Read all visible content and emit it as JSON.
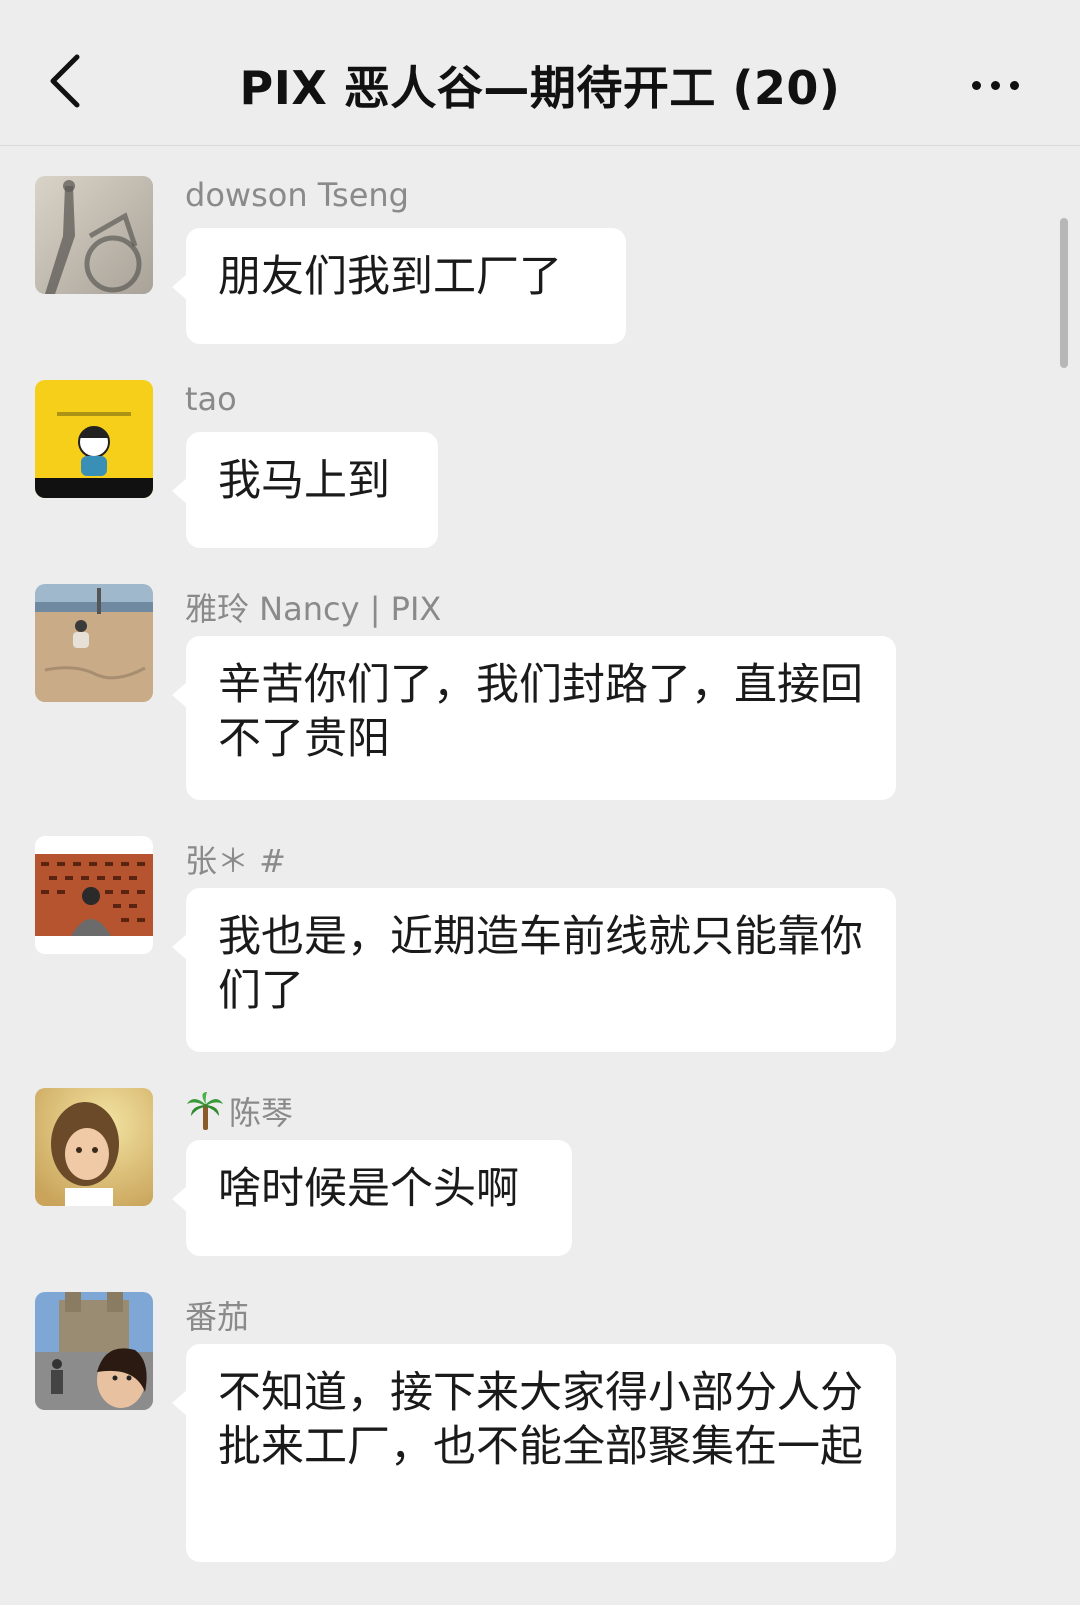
{
  "header": {
    "title": "PIX 恶人谷—期待开工 (20)"
  },
  "messages": [
    {
      "sender": "dowson Tseng",
      "text": "朋友们我到工厂了"
    },
    {
      "sender": "tao",
      "text": "我马上到"
    },
    {
      "sender": "雅玲 Nancy | PIX",
      "text": "辛苦你们了，我们封路了，直接回不了贵阳"
    },
    {
      "sender": "张＊ #",
      "text": "我也是，近期造车前线就只能靠你们了"
    },
    {
      "sender": "陈琴",
      "text": "啥时候是个头啊"
    },
    {
      "sender": "番茄",
      "text": "不知道，接下来大家得小部分人分批来工厂，也不能全部聚集在一起"
    }
  ]
}
